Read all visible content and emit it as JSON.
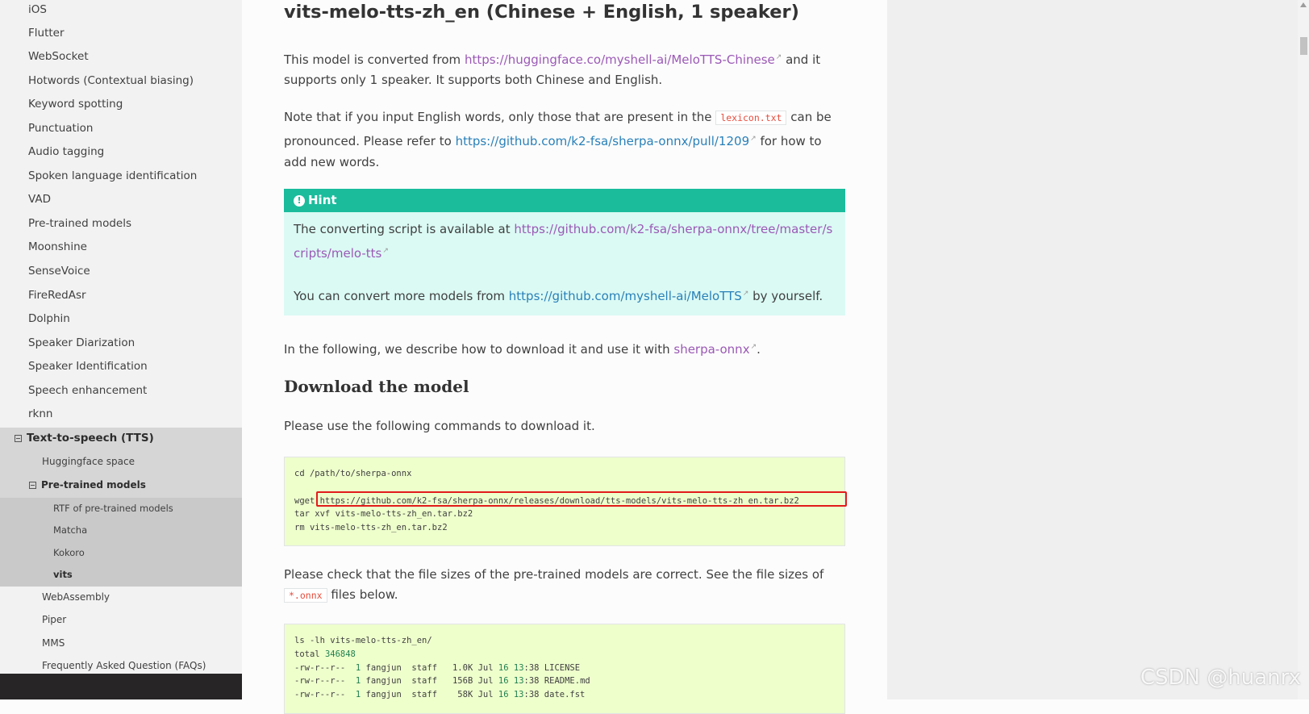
{
  "sidebar": {
    "items": [
      {
        "label": "iOS"
      },
      {
        "label": "Flutter"
      },
      {
        "label": "WebSocket"
      },
      {
        "label": "Hotwords (Contextual biasing)"
      },
      {
        "label": "Keyword spotting"
      },
      {
        "label": "Punctuation"
      },
      {
        "label": "Audio tagging"
      },
      {
        "label": "Spoken language identification"
      },
      {
        "label": "VAD"
      },
      {
        "label": "Pre-trained models"
      },
      {
        "label": "Moonshine"
      },
      {
        "label": "SenseVoice"
      },
      {
        "label": "FireRedAsr"
      },
      {
        "label": "Dolphin"
      },
      {
        "label": "Speaker Diarization"
      },
      {
        "label": "Speaker Identification"
      },
      {
        "label": "Speech enhancement"
      },
      {
        "label": "rknn"
      }
    ],
    "tts": {
      "label": "Text-to-speech (TTS)",
      "children": [
        {
          "label": "Huggingface space"
        },
        {
          "label": "Pre-trained models"
        },
        {
          "label": "RTF of pre-trained models"
        },
        {
          "label": "Matcha"
        },
        {
          "label": "Kokoro"
        },
        {
          "label": "vits"
        },
        {
          "label": "WebAssembly"
        },
        {
          "label": "Piper"
        },
        {
          "label": "MMS"
        },
        {
          "label": "Frequently Asked Question (FAQs)"
        }
      ]
    }
  },
  "main": {
    "title": "vits-melo-tts-zh_en (Chinese + English, 1 speaker)",
    "p1": {
      "before": "This model is converted from ",
      "link": "https://huggingface.co/myshell-ai/MeloTTS-Chinese",
      "after": " and it supports only 1 speaker. It supports both Chinese and English."
    },
    "p2": {
      "before": "Note that if you input English words, only those that are present in the ",
      "code": "lexicon.txt",
      "middle": " can be pronounced. Please refer to ",
      "link": "https://github.com/k2-fsa/sherpa-onnx/pull/1209",
      "after": " for how to add new words."
    },
    "hint": {
      "title": "Hint",
      "p1_before": "The converting script is available at ",
      "p1_link": "https://github.com/k2-fsa/sherpa-onnx/tree/master/scripts/melo-tts",
      "p2_before": "You can convert more models from ",
      "p2_link": "https://github.com/myshell-ai/MeloTTS",
      "p2_after": " by yourself."
    },
    "p3": {
      "before": "In the following, we describe how to download it and use it with ",
      "link": "sherpa-onnx",
      "after": "."
    },
    "download_heading": "Download the model",
    "p4": "Please use the following commands to download it.",
    "code1": {
      "line1": "cd /path/to/sherpa-onnx",
      "wget": "wget ",
      "url": "https://github.com/k2-fsa/sherpa-onnx/releases/download/tts-models/vits-melo-tts-zh_en.tar.bz2",
      "line3": "tar xvf vits-melo-tts-zh_en.tar.bz2",
      "line4": "rm vits-melo-tts-zh_en.tar.bz2"
    },
    "p5": {
      "before": "Please check that the file sizes of the pre-trained models are correct. See the file sizes of ",
      "code": "*.onnx",
      "after": " files below."
    },
    "code2": {
      "line1": "ls -lh vits-melo-tts-zh_en/",
      "total_label": "total ",
      "total_value": "346848",
      "rows": [
        {
          "perm": "-rw-r--r--  ",
          "links": "1",
          "owner": " fangjun  staff   ",
          "size": "1.0K",
          "mon": " Jul ",
          "day": "16",
          "time": " ",
          "hh": "13",
          "rest": ":38 LICENSE"
        },
        {
          "perm": "-rw-r--r--  ",
          "links": "1",
          "owner": " fangjun  staff   ",
          "size": "156B",
          "mon": " Jul ",
          "day": "16",
          "time": " ",
          "hh": "13",
          "rest": ":38 README.md"
        },
        {
          "perm": "-rw-r--r--  ",
          "links": "1",
          "owner": " fangjun  staff    ",
          "size": "58K",
          "mon": " Jul ",
          "day": "16",
          "time": " ",
          "hh": "13",
          "rest": ":38 date.fst"
        }
      ]
    }
  },
  "watermark": "CSDN @huanrx"
}
